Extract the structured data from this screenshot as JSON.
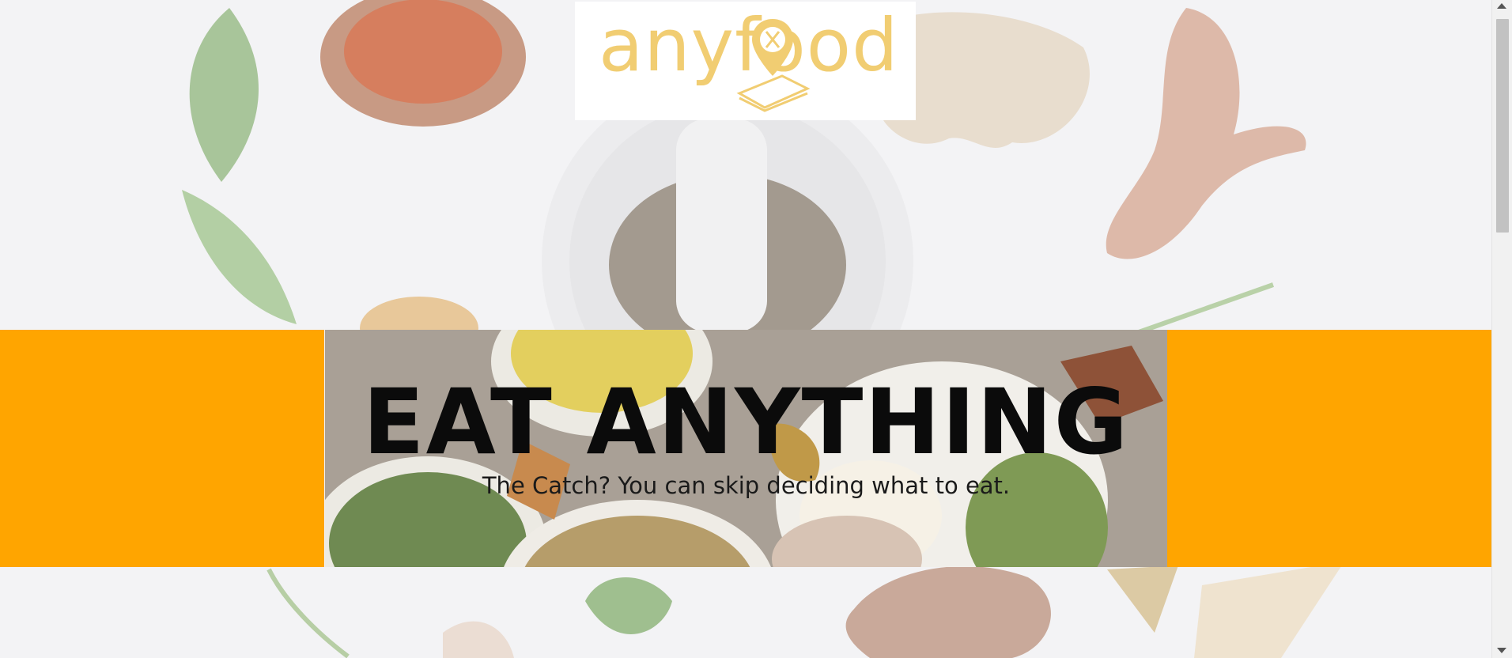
{
  "brand": {
    "logo_text": "anyfood",
    "logo_color": "#f1cd72",
    "logo_icons": [
      "map-pin-utensils-icon",
      "smartphone-icon"
    ]
  },
  "hero": {
    "title": "EAT ANYTHING",
    "subtitle": "The Catch? You can skip deciding what to eat.",
    "band_color": "#ffa500"
  },
  "colors": {
    "page_background": "#f2f2f4",
    "hero_background": "#a9a096"
  },
  "scrollbar": {
    "icons": [
      "scroll-up-arrow-icon",
      "scroll-down-arrow-icon"
    ]
  }
}
